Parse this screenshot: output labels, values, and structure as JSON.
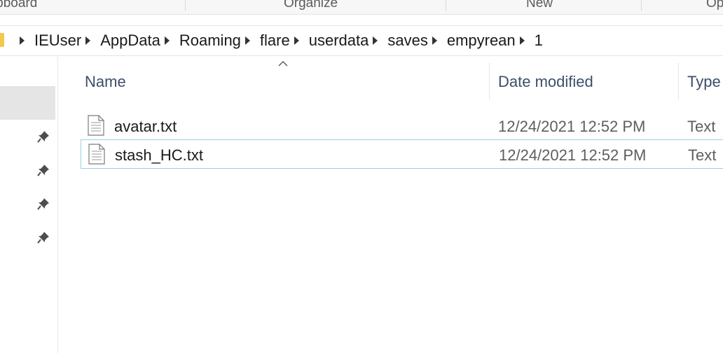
{
  "ribbon": {
    "groups": [
      "Clipboard",
      "Organize",
      "New",
      "Open"
    ]
  },
  "address_bar": {
    "crumbs": [
      "IEUser",
      "AppData",
      "Roaming",
      "flare",
      "userdata",
      "saves",
      "empyrean",
      "1"
    ]
  },
  "file_list": {
    "columns": {
      "name": "Name",
      "date_modified": "Date modified",
      "type": "Type"
    },
    "files": [
      {
        "name": "avatar.txt",
        "date_modified": "12/24/2021 12:52 PM",
        "type": "Text"
      },
      {
        "name": "stash_HC.txt",
        "date_modified": "12/24/2021 12:52 PM",
        "type": "Text"
      }
    ]
  },
  "icons": {
    "folder": "folder-icon",
    "pin": "pin-icon",
    "file": "text-file-icon",
    "sort": "sort-ascending-icon",
    "chevron": "chevron-right-icon"
  },
  "colors": {
    "header_text": "#3c4e68",
    "selection_border": "#99d1e5",
    "nav_selected": "#e5e5e5"
  }
}
